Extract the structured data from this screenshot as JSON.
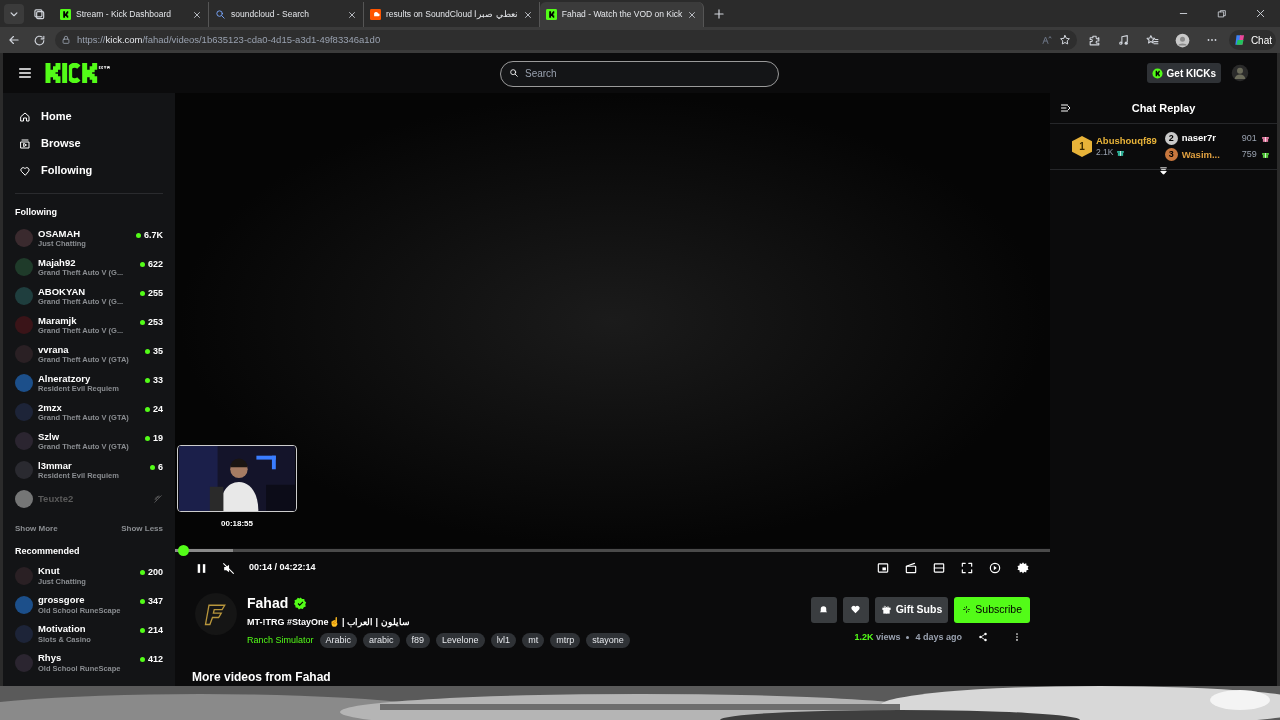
{
  "browser": {
    "tabs": [
      {
        "title": "Stream - Kick Dashboard",
        "selected": false
      },
      {
        "title": "soundcloud - Search",
        "selected": false
      },
      {
        "title": "results on SoundCloud نعطي صبرا",
        "selected": false
      },
      {
        "title": "Fahad - Watch the VOD on Kick",
        "selected": true
      }
    ],
    "url_prefix": "https://",
    "url_host": "kick.com",
    "url_path": "/fahad/videos/1b635123-cda0-4d15-a3d1-49f83346a1d0",
    "chat_button": "Chat"
  },
  "header": {
    "search": {
      "placeholder": "Search"
    },
    "get_kicks": "Get KICKs"
  },
  "sidebar": {
    "nav": [
      {
        "label": "Home"
      },
      {
        "label": "Browse"
      },
      {
        "label": "Following"
      }
    ],
    "following_title": "Following",
    "following": [
      {
        "name": "OSAMAH",
        "category": "Just Chatting",
        "viewers": "6.7K",
        "live": true
      },
      {
        "name": "Majah92",
        "category": "Grand Theft Auto V (G...",
        "viewers": "622",
        "live": true
      },
      {
        "name": "ABOKYAN",
        "category": "Grand Theft Auto V (G...",
        "viewers": "255",
        "live": true
      },
      {
        "name": "Maramjk",
        "category": "Grand Theft Auto V (G...",
        "viewers": "253",
        "live": true
      },
      {
        "name": "vvrana",
        "category": "Grand Theft Auto V (GTA)",
        "viewers": "35",
        "live": true
      },
      {
        "name": "Alneratzory",
        "category": "Resident Evil Requiem",
        "viewers": "33",
        "live": true
      },
      {
        "name": "2mzx",
        "category": "Grand Theft Auto V (GTA)",
        "viewers": "24",
        "live": true
      },
      {
        "name": "Szlw",
        "category": "Grand Theft Auto V (GTA)",
        "viewers": "19",
        "live": true
      },
      {
        "name": "l3mmar",
        "category": "Resident Evil Requiem",
        "viewers": "6",
        "live": true
      },
      {
        "name": "Teuxte2",
        "live": false
      }
    ],
    "show_more": "Show More",
    "show_less": "Show Less",
    "recommended_title": "Recommended",
    "recommended": [
      {
        "name": "Knut",
        "category": "Just Chatting",
        "viewers": "200",
        "live": true
      },
      {
        "name": "grossgore",
        "category": "Old School RuneScape",
        "viewers": "347",
        "live": true
      },
      {
        "name": "Motivation",
        "category": "Slots & Casino",
        "viewers": "214",
        "live": true
      },
      {
        "name": "Rhys",
        "category": "Old School RuneScape",
        "viewers": "412",
        "live": true
      }
    ]
  },
  "player": {
    "preview_time": "00:18:55",
    "progress": {
      "level": 0.005
    },
    "buffered": {
      "level": 0.066
    },
    "paused": false,
    "muted": true,
    "time": "00:14 / 04:22:14"
  },
  "channel": {
    "name": "Fahad",
    "verified": true,
    "title": "MT-!TRG #StayOne☝ | سايلون | العراب",
    "category": "Ranch Simulator",
    "tags": [
      "Arabic",
      "arabic",
      "f89",
      "Levelone",
      "lvl1",
      "mt",
      "mtrp",
      "stayone"
    ],
    "gift_subs": "Gift Subs",
    "subscribe": "Subscribe",
    "views_count": "1.2K",
    "views_label": "views",
    "age": "4 days ago"
  },
  "more_videos": "More videos from Fahad",
  "chat": {
    "title": "Chat Replay",
    "leaderboard": [
      {
        "rank": "1",
        "name": "Abushouqf89",
        "amount": "2.1K"
      },
      {
        "rank": "2",
        "name": "naser7r",
        "amount": "901"
      },
      {
        "rank": "3",
        "name": "Wasim...",
        "amount": "759"
      }
    ]
  }
}
